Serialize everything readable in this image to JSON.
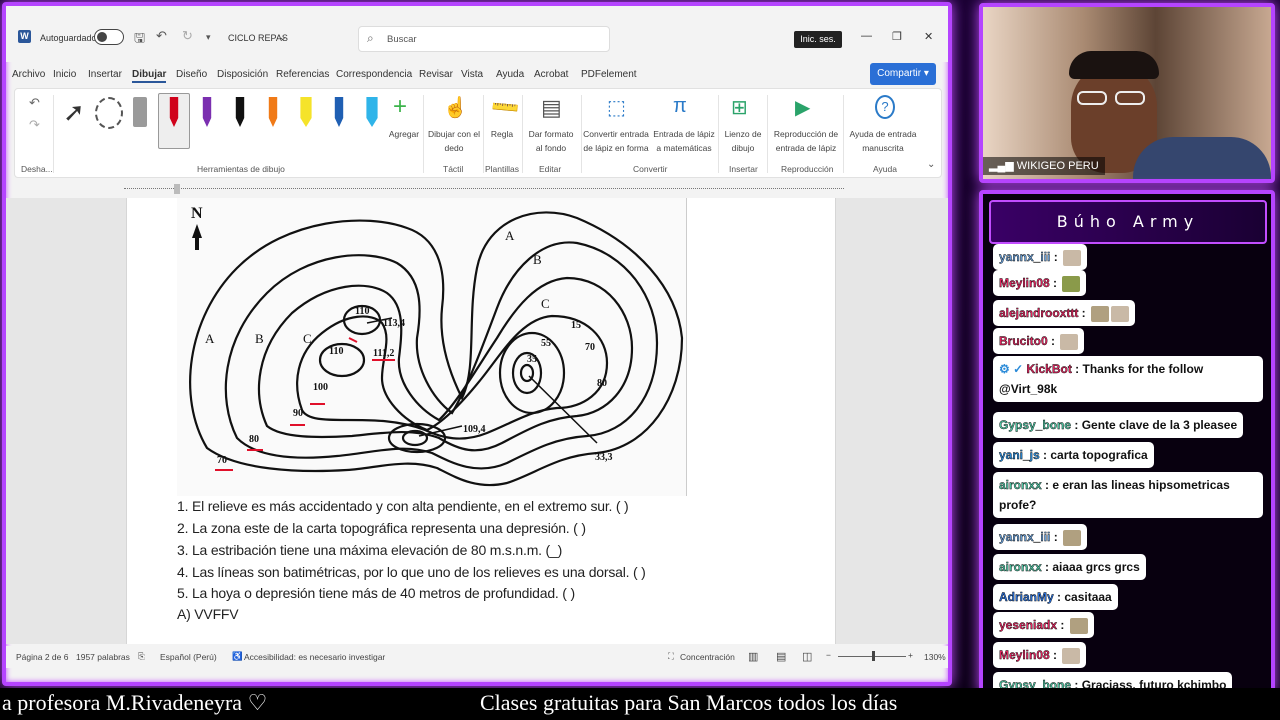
{
  "word": {
    "autosave_label": "Autoguardado",
    "doc_title": "CICLO REPAS",
    "search_placeholder": "Buscar",
    "signin_label": "Inic. ses.",
    "window_controls": [
      "—",
      "❐",
      "✕"
    ],
    "menu": [
      "Archivo",
      "Inicio",
      "Insertar",
      "Dibujar",
      "Diseño",
      "Disposición",
      "Referencias",
      "Correspondencia",
      "Revisar",
      "Vista",
      "Ayuda",
      "Acrobat",
      "PDFelement"
    ],
    "active_menu": "Dibujar",
    "share_label": "Compartir",
    "ribbon": {
      "undo_group": "Desha...",
      "drawing_tools_group": "Herramientas de dibujo",
      "add_label": "Agregar",
      "tactil_group": "Táctil",
      "draw_with_finger": "Dibujar con el dedo",
      "templates_group": "Plantillas",
      "ruler_label": "Regla",
      "edit_group": "Editar",
      "format_background": "Dar formato al fondo",
      "convert_group": "Convertir",
      "ink_to_shape": "Convertir entrada de lápiz en forma",
      "ink_to_math": "Entrada de lápiz a matemáticas",
      "insert_group": "Insertar",
      "drawing_canvas": "Lienzo de dibujo",
      "playback_group": "Reproducción",
      "ink_replay": "Reproducción de entrada de lápiz",
      "help_group": "Ayuda",
      "ink_help": "Ayuda de entrada manuscrita"
    },
    "pen_colors": [
      "#9a9a9a",
      "#d0021b",
      "#7b2fb0",
      "#111111",
      "#f07a17",
      "#f5e32a",
      "#1f5fb3",
      "#2fb4e9"
    ],
    "map_labels": {
      "north": "N",
      "left_a": "A",
      "left_b": "B",
      "left_c": "C",
      "right_a": "A",
      "right_b": "B",
      "right_c": "C",
      "h110": "110",
      "h113_4": "113,4",
      "h110b": "110",
      "h111_2": "111,2",
      "h100": "100",
      "h90": "90",
      "h80": "80",
      "h70": "70",
      "h109_4": "109,4",
      "h55": "55",
      "h15": "15",
      "h70r": "70",
      "h80r": "80",
      "h35": "35",
      "h33_3": "33,3"
    },
    "questions": [
      "1. El relieve es más accidentado y con alta pendiente, en el extremo sur. ( )",
      "2. La zona este de la carta topográfica representa una depresión. ( )",
      "3. La estribación tiene una máxima elevación de 80 m.s.n.m. (_)",
      "4. Las líneas son batimétricas, por lo que uno de los relieves es una dorsal. ( )",
      "5. La hoya o depresión tiene más de 40 metros de profundidad. ( )",
      "A) VVFFV"
    ],
    "status": {
      "page": "Página 2 de 6",
      "words": "1957 palabras",
      "language": "Español (Perú)",
      "accessibility": "Accesibilidad: es necesario investigar",
      "focus": "Concentración",
      "zoom": "130%"
    }
  },
  "webcam": {
    "name_tag": "WIKIGEO PERU"
  },
  "chat": {
    "title": "Búho Army",
    "messages": [
      {
        "user": "yannx_iii",
        "text": "",
        "color": "#6aa0d8",
        "emotes": 1
      },
      {
        "user": "Meylin08",
        "text": "",
        "color": "#e0245e",
        "emotes": 1
      },
      {
        "user": "alejandrooxttt",
        "text": "",
        "color": "#e0245e",
        "emotes": 2
      },
      {
        "user": "Brucito0",
        "text": "",
        "color": "#e0245e",
        "emotes": 1
      },
      {
        "user": "KickBot",
        "text": "Thanks for the follow @Virt_98k",
        "color": "#e0245e",
        "emotes": 0
      },
      {
        "user": "Gypsy_bone",
        "text": "Gente clave de la 3 pleasee",
        "color": "#4fc3a1",
        "emotes": 0
      },
      {
        "user": "yani_js",
        "text": "carta topografica",
        "color": "#2a8ad8",
        "emotes": 0
      },
      {
        "user": "aironxx",
        "text": "e eran las lineas hipsometricas profe?",
        "color": "#4fc3a1",
        "emotes": 0
      },
      {
        "user": "yannx_iii",
        "text": "",
        "color": "#6aa0d8",
        "emotes": 1
      },
      {
        "user": "aironxx",
        "text": "aiaaa grcs grcs",
        "color": "#4fc3a1",
        "emotes": 0
      },
      {
        "user": "AdrianMy",
        "text": "casitaaa",
        "color": "#2a6fd6",
        "emotes": 0
      },
      {
        "user": "yeseniadx",
        "text": "",
        "color": "#e0245e",
        "emotes": 1
      },
      {
        "user": "Meylin08",
        "text": "",
        "color": "#e0245e",
        "emotes": 1
      },
      {
        "user": "Gypsy_bone",
        "text": "Graciass, futuro kchimbo",
        "color": "#4fc3a1",
        "emotes": 0
      }
    ]
  },
  "ticker": {
    "left": "a profesora M.Rivadeneyra ♡",
    "right": "Clases gratuitas para San Marcos todos los días"
  }
}
